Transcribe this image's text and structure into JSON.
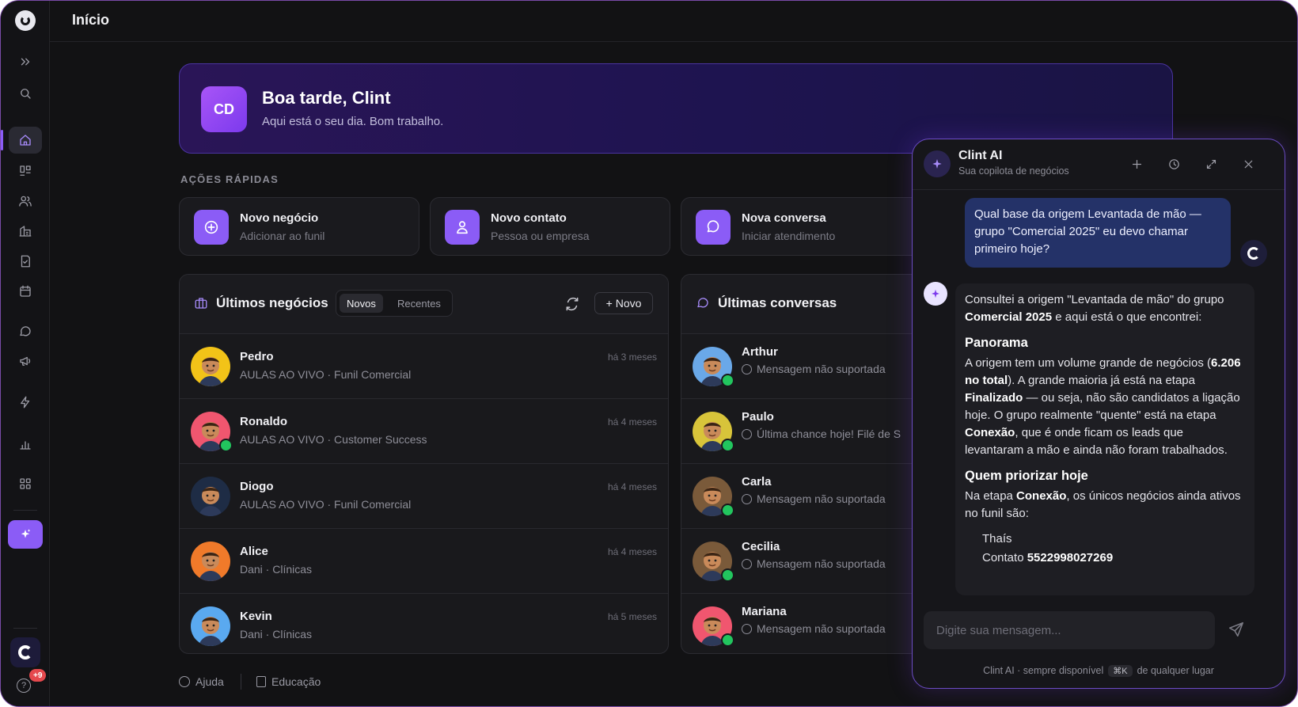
{
  "topbar": {
    "title": "Início"
  },
  "hero": {
    "initials": "CD",
    "greeting": "Boa tarde, Clint",
    "subtitle": "Aqui está o seu dia. Bom trabalho."
  },
  "quick_actions": {
    "label": "AÇÕES RÁPIDAS",
    "items": [
      {
        "title": "Novo negócio",
        "subtitle": "Adicionar ao funil",
        "icon": "plus-circle-icon"
      },
      {
        "title": "Novo contato",
        "subtitle": "Pessoa ou empresa",
        "icon": "user-icon"
      },
      {
        "title": "Nova conversa",
        "subtitle": "Iniciar atendimento",
        "icon": "chat-icon"
      }
    ]
  },
  "deals": {
    "title": "Últimos negócios",
    "tabs": [
      "Novos",
      "Recentes"
    ],
    "new_button": "Novo",
    "rows": [
      {
        "name": "Pedro",
        "sub": "AULAS AO VIVO · Funil Comercial",
        "time": "há 3 meses",
        "avatar_color": "#f2c318",
        "whatsapp": false
      },
      {
        "name": "Ronaldo",
        "sub": "AULAS AO VIVO · Customer Success",
        "time": "há 4 meses",
        "avatar_color": "#f0566f",
        "whatsapp": true
      },
      {
        "name": "Diogo",
        "sub": "AULAS AO VIVO · Funil Comercial",
        "time": "há 4 meses",
        "avatar_color": "#1e2c45",
        "whatsapp": false
      },
      {
        "name": "Alice",
        "sub": "Dani · Clínicas",
        "time": "há 4 meses",
        "avatar_color": "#f07a2a",
        "whatsapp": false
      },
      {
        "name": "Kevin",
        "sub": "Dani · Clínicas",
        "time": "há 5 meses",
        "avatar_color": "#5aa9f0",
        "whatsapp": false
      }
    ]
  },
  "conversations": {
    "title": "Últimas conversas",
    "rows": [
      {
        "name": "Arthur",
        "msg": "Mensagem não suportada",
        "avatar_color": "#6aa8e8"
      },
      {
        "name": "Paulo",
        "msg": "Última chance hoje! Filé de S",
        "avatar_color": "#d8c43a"
      },
      {
        "name": "Carla",
        "msg": "Mensagem não suportada",
        "avatar_color": "#7a5a3a"
      },
      {
        "name": "Cecilia",
        "msg": "Mensagem não suportada",
        "avatar_color": "#7a5a3a"
      },
      {
        "name": "Mariana",
        "msg": "Mensagem não suportada",
        "avatar_color": "#f0566f"
      }
    ]
  },
  "footer": {
    "help": "Ajuda",
    "education": "Educação"
  },
  "sidebar": {
    "badge": "+9"
  },
  "ai": {
    "name": "Clint AI",
    "subtitle": "Sua copilota de negócios",
    "user_message": "Qual base da origem Levantada de mão — grupo \"Comercial 2025\" eu devo chamar primeiro hoje?",
    "reply": {
      "intro_a": "Consultei a origem \"Levantada de mão\" do grupo ",
      "intro_b": "Comercial 2025",
      "intro_c": " e aqui está o que encontrei:",
      "h1": "Panorama",
      "p1_a": "A origem tem um volume grande de negócios (",
      "p1_b": "6.206 no total",
      "p1_c": "). A grande maioria já está na etapa ",
      "p1_d": "Finalizado",
      "p1_e": " — ou seja, não são candidatos a ligação hoje. O grupo realmente \"quente\" está na etapa ",
      "p1_f": "Conexão",
      "p1_g": ", que é onde ficam os leads que levantaram a mão e ainda não foram trabalhados.",
      "h2": "Quem priorizar hoje",
      "p2_a": "Na etapa ",
      "p2_b": "Conexão",
      "p2_c": ", os únicos negócios ainda ativos no funil são:",
      "lead_name": "Thaís",
      "lead_contact_a": "Contato ",
      "lead_contact_b": "5522998027269"
    },
    "input_placeholder": "Digite sua mensagem...",
    "footer_a": "Clint AI · sempre disponível",
    "footer_kbd": "⌘K",
    "footer_b": "de qualquer lugar"
  }
}
